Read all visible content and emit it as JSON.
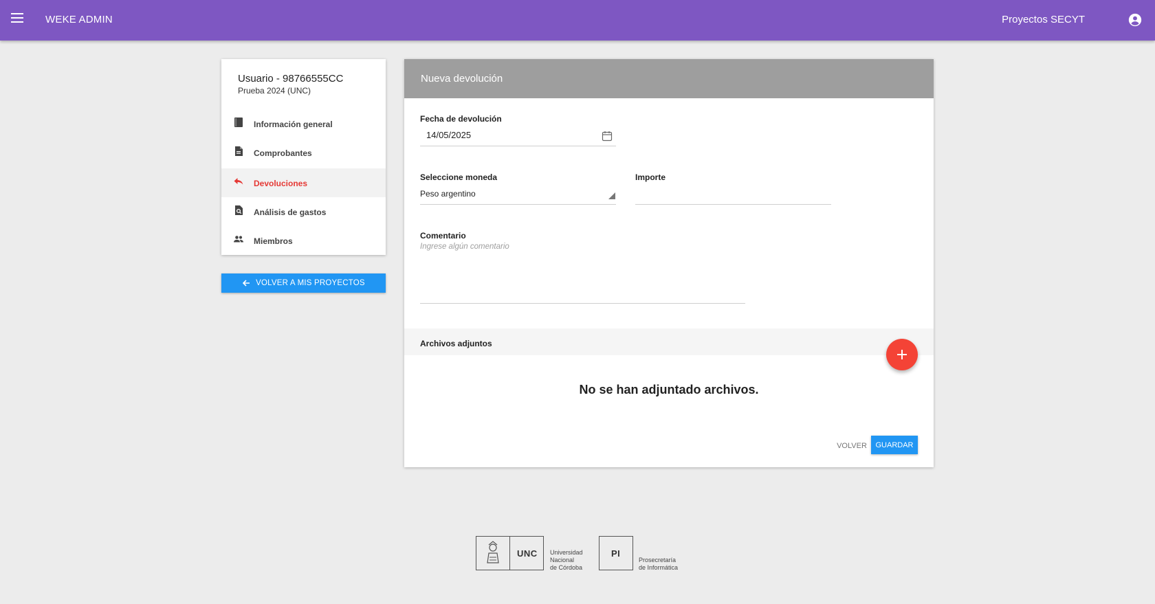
{
  "header": {
    "app_title": "WEKE ADMIN",
    "user_label": "Proyectos SECYT",
    "bar_color": "#7e57c2"
  },
  "sidebar": {
    "title": "Usuario - 98766555CC",
    "subtitle": "Prueba 2024 (UNC)",
    "items": [
      {
        "label": "Información general",
        "icon": "book-icon",
        "active": false
      },
      {
        "label": "Comprobantes",
        "icon": "document-icon",
        "active": false
      },
      {
        "label": "Devoluciones",
        "icon": "reply-icon",
        "active": true
      },
      {
        "label": "Análisis de gastos",
        "icon": "search-document-icon",
        "active": false
      },
      {
        "label": "Miembros",
        "icon": "people-icon",
        "active": false
      }
    ],
    "back_button": "VOLVER A MIS PROYECTOS"
  },
  "form": {
    "title": "Nueva devolución",
    "date_label": "Fecha de devolución",
    "date_value": "14/05/2025",
    "currency_label": "Seleccione moneda",
    "currency_value": "Peso argentino",
    "amount_label": "Importe",
    "amount_value": "",
    "comment_label": "Comentario",
    "comment_placeholder": "Ingrese algún comentario",
    "attachments_label": "Archivos adjuntos",
    "empty_message": "No se han adjuntado archivos.",
    "cancel_button": "VOLVER",
    "save_button": "GUARDAR"
  },
  "footer": {
    "logo1_abbr": "UNC",
    "logo1_line1": "Universidad",
    "logo1_line2": "Nacional",
    "logo1_line3": "de Córdoba",
    "logo2_abbr": "PI",
    "logo2_line1": "Prosecretaría",
    "logo2_line2": "de Informática"
  },
  "colors": {
    "accent": "#2196f3",
    "active_nav": "#e53935",
    "fab": "#f44336",
    "card_header": "#9e9e9e"
  }
}
